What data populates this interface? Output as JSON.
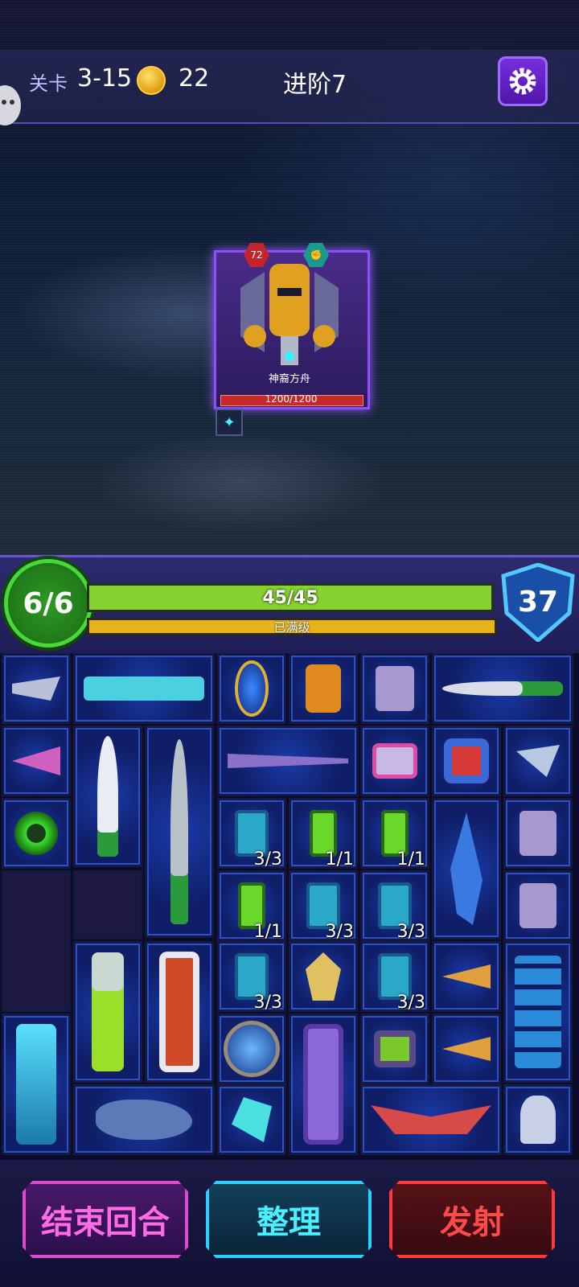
{
  "header": {
    "level_label": "关卡",
    "level_value": "3-15",
    "coins": "22",
    "advance": "进阶7"
  },
  "enemy": {
    "name": "神裔方舟",
    "hp": "1200/1200",
    "badge_level": "72"
  },
  "status": {
    "turns": "6/6",
    "hp": "45/45",
    "xp_label": "已满级",
    "shield": "37"
  },
  "grid_counts": {
    "c1": "3/3",
    "c2": "1/1",
    "c3": "1/1",
    "c4": "1/1",
    "c5": "3/3",
    "c6": "3/3",
    "c7": "3/3",
    "c8": "3/3"
  },
  "actions": {
    "end_turn": "结束回合",
    "arrange": "整理",
    "fire": "发射"
  },
  "colors": {
    "accent": "#7a2fe0",
    "hp": "#86d231",
    "xp": "#e8b318",
    "end": "#ff4fd8",
    "arrange": "#3ad8ff",
    "fire": "#ff4040"
  }
}
